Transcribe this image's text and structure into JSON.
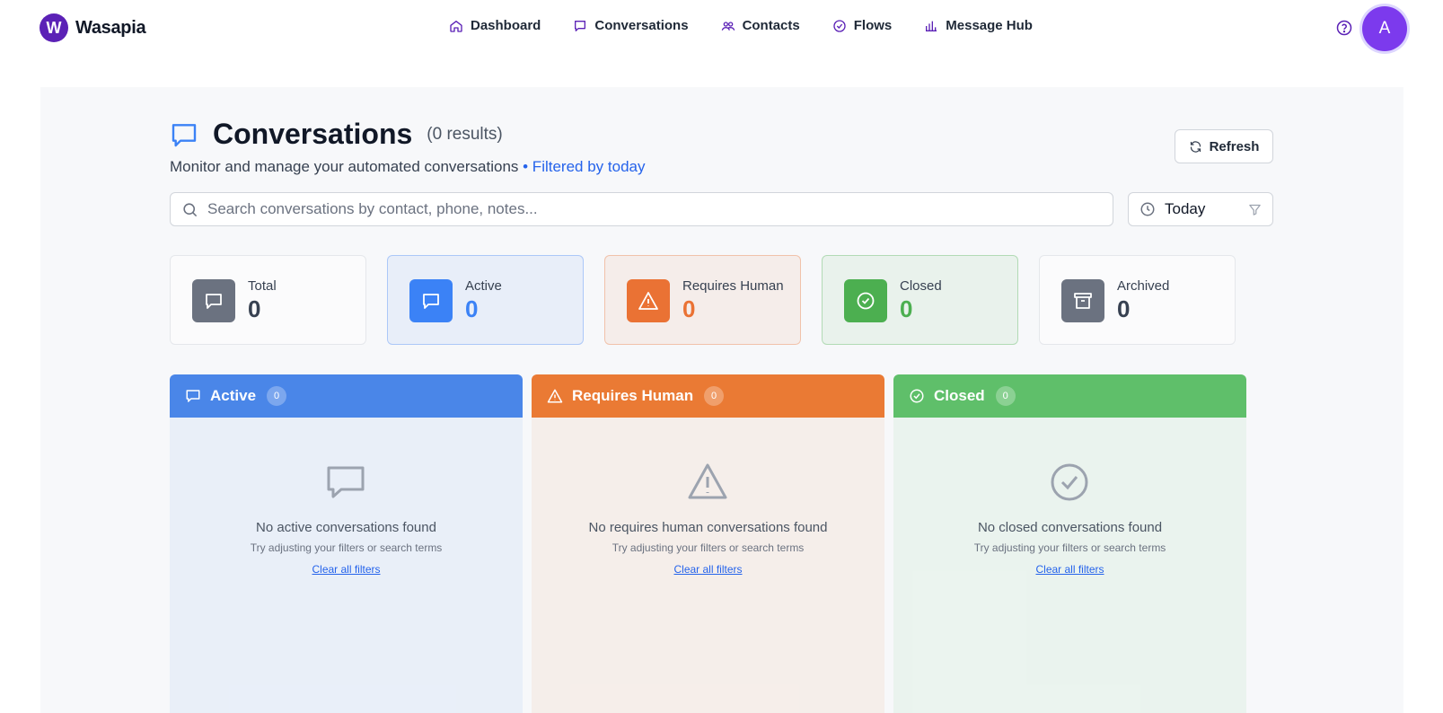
{
  "brand": {
    "logo_letter": "W",
    "name": "Wasapia"
  },
  "nav": [
    {
      "label": "Dashboard",
      "icon": "home-icon"
    },
    {
      "label": "Conversations",
      "icon": "chat-icon"
    },
    {
      "label": "Contacts",
      "icon": "users-icon"
    },
    {
      "label": "Flows",
      "icon": "check-circle-icon"
    },
    {
      "label": "Message Hub",
      "icon": "bar-chart-icon"
    }
  ],
  "user": {
    "avatar_letter": "A"
  },
  "header": {
    "title": "Conversations",
    "result_count": "(0 results)",
    "subtitle": "Monitor and manage your automated conversations",
    "filter_note": " • Filtered by today",
    "refresh_label": "Refresh"
  },
  "search": {
    "placeholder": "Search conversations by contact, phone, notes...",
    "value": ""
  },
  "date_filter": {
    "selected": "Today"
  },
  "stats": [
    {
      "label": "Total",
      "value": "0",
      "color": "#6b7280"
    },
    {
      "label": "Active",
      "value": "0",
      "color": "#3b82f6"
    },
    {
      "label": "Requires Human",
      "value": "0",
      "color": "#ea7234"
    },
    {
      "label": "Closed",
      "value": "0",
      "color": "#4caf50"
    },
    {
      "label": "Archived",
      "value": "0",
      "color": "#6b7280"
    }
  ],
  "columns": [
    {
      "title": "Active",
      "count": "0",
      "color": "#4a86e8",
      "empty_title": "No active conversations found",
      "empty_hint": "Try adjusting your filters or search terms",
      "clear_label": "Clear all filters"
    },
    {
      "title": "Requires Human",
      "count": "0",
      "color": "#ea7a34",
      "empty_title": "No requires human conversations found",
      "empty_hint": "Try adjusting your filters or search terms",
      "clear_label": "Clear all filters"
    },
    {
      "title": "Closed",
      "count": "0",
      "color": "#5fbf6a",
      "empty_title": "No closed conversations found",
      "empty_hint": "Try adjusting your filters or search terms",
      "clear_label": "Clear all filters"
    }
  ]
}
